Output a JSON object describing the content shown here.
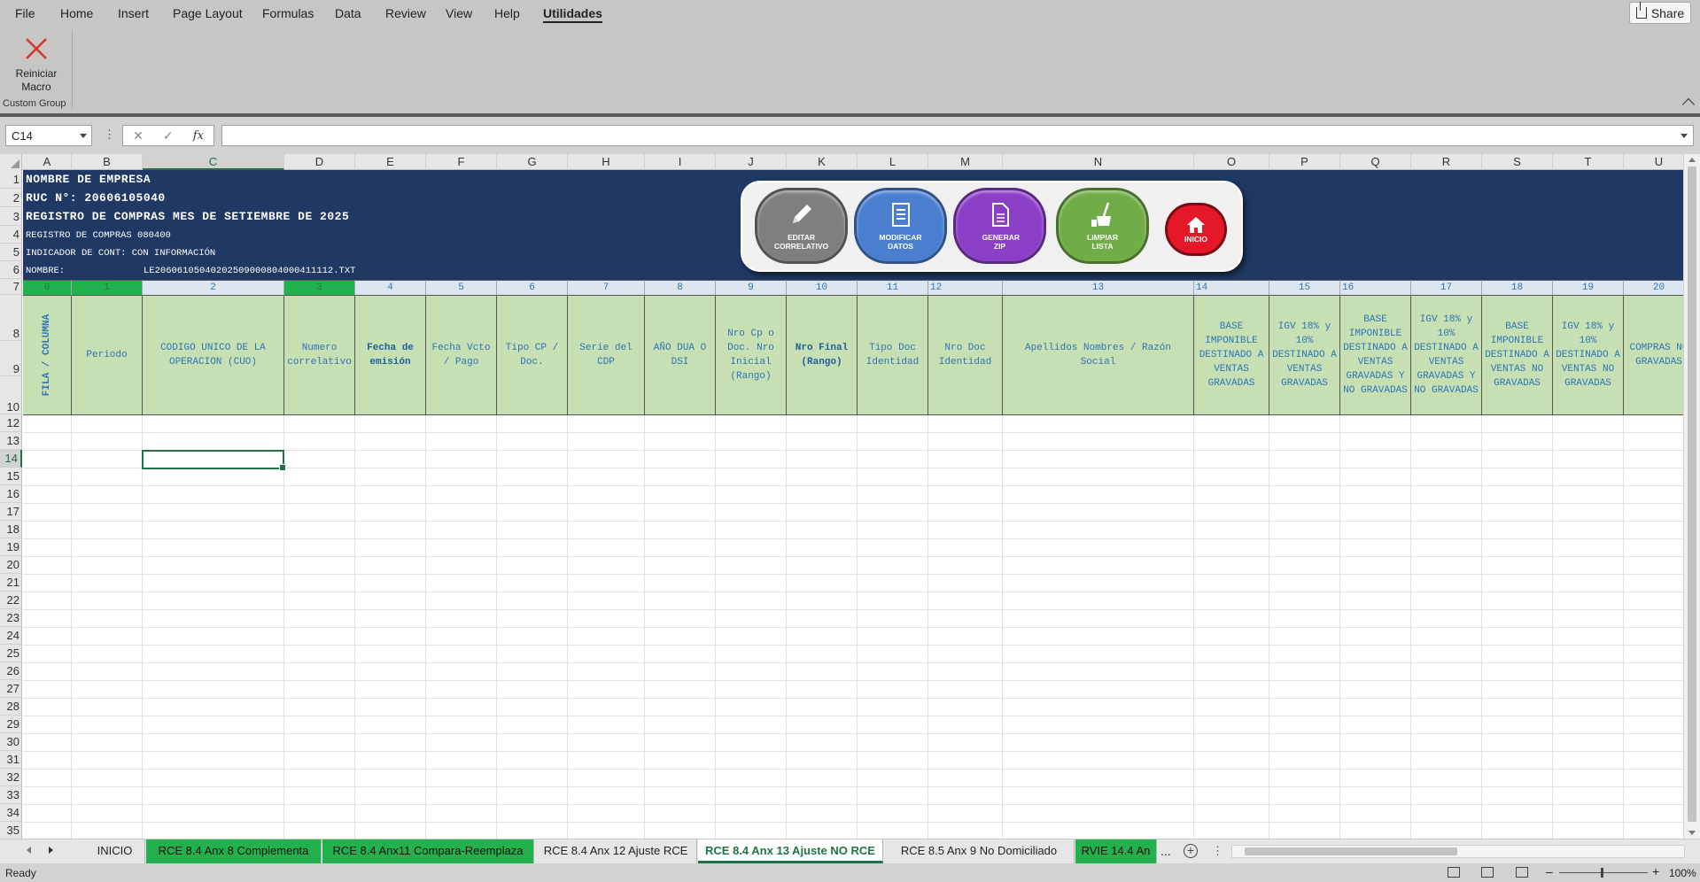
{
  "menu": [
    "File",
    "Home",
    "Insert",
    "Page Layout",
    "Formulas",
    "Data",
    "Review",
    "View",
    "Help",
    "Utilidades"
  ],
  "active_menu": "Utilidades",
  "share_label": "Share",
  "ribbon": {
    "macro_label_1": "Reiniciar",
    "macro_label_2": "Macro",
    "group_label": "Custom Group"
  },
  "formula_bar": {
    "name_box": "C14",
    "formula": "",
    "fx": "fx"
  },
  "columns": [
    "A",
    "B",
    "C",
    "D",
    "E",
    "F",
    "G",
    "H",
    "I",
    "J",
    "K",
    "L",
    "M",
    "N",
    "O",
    "P",
    "Q",
    "R",
    "S",
    "T",
    "U"
  ],
  "selected_column": "C",
  "rows": [
    "1",
    "2",
    "3",
    "4",
    "5",
    "6",
    "7",
    "8",
    "9",
    "10",
    "12",
    "13",
    "14",
    "15",
    "16",
    "17",
    "18",
    "19",
    "20",
    "21",
    "22",
    "23",
    "24",
    "25",
    "26",
    "27",
    "28",
    "29",
    "30",
    "31",
    "32",
    "33",
    "34",
    "35"
  ],
  "selected_row": "14",
  "banner": {
    "empresa": "NOMBRE DE EMPRESA",
    "ruc": "RUC N°: 20606105040",
    "titulo": "REGISTRO DE COMPRAS MES DE SETIEMBRE DE 2025",
    "registro": "REGISTRO DE COMPRAS 080400",
    "indicador": "INDICADOR DE CONT: CON INFORMACIÓN",
    "nombre_label": "NOMBRE:",
    "nombre_value": "LE20606105040202509000804000411112.TXT"
  },
  "buttons": {
    "editar": "EDITAR CORRELATIVO",
    "modificar": "MODIFICAR DATOS",
    "generar": "GENERAR ZIP",
    "limpiar": "LIMPIAR LISTA",
    "inicio": "INICIO"
  },
  "column_numbers": [
    "0",
    "1",
    "2",
    "3",
    "4",
    "5",
    "6",
    "7",
    "8",
    "9",
    "10",
    "11",
    "12",
    "13",
    "14",
    "15",
    "16",
    "17",
    "18",
    "19",
    "20"
  ],
  "headers": [
    "FILA / COLUMNA",
    "Periodo",
    "CODIGO UNICO DE LA OPERACION (CUO)",
    "Numero correlativo",
    "Fecha de emisión",
    "Fecha Vcto / Pago",
    "Tipo CP / Doc.",
    "Serie del CDP",
    "AÑO DUA O DSI",
    "Nro Cp o Doc. Nro Inicial (Rango)",
    "Nro Final (Rango)",
    "Tipo Doc Identidad",
    "Nro Doc Identidad",
    "Apellidos Nombres / Razón Social",
    "BASE IMPONIBLE DESTINADO A VENTAS GRAVADAS",
    "IGV 18% y 10% DESTINADO A VENTAS GRAVADAS",
    "BASE IMPONIBLE DESTINADO A VENTAS GRAVADAS Y NO GRAVADAS",
    "IGV 18% y 10% DESTINADO A VENTAS GRAVADAS Y NO GRAVADAS",
    "BASE IMPONIBLE DESTINADO A VENTAS NO GRAVADAS",
    "IGV 18% y 10% DESTINADO A VENTAS NO GRAVADAS",
    "COMPRAS NO GRAVADAS"
  ],
  "sheet_tabs": [
    {
      "label": "INICIO",
      "style": "plain"
    },
    {
      "label": "RCE 8.4 Anx 8 Complementa",
      "style": "green"
    },
    {
      "label": "RCE 8.4 Anx11 Compara-Reemplaza",
      "style": "green"
    },
    {
      "label": "RCE 8.4 Anx 12 Ajuste RCE",
      "style": "plain"
    },
    {
      "label": "RCE 8.4 Anx 13 Ajuste NO RCE",
      "style": "active"
    },
    {
      "label": "RCE 8.5 Anx 9 No Domiciliado",
      "style": "plain"
    },
    {
      "label": "RVIE 14.4 An",
      "style": "green"
    }
  ],
  "tab_ellipsis": "...",
  "status": {
    "ready": "Ready",
    "zoom": "100%"
  },
  "colors": {
    "banner": "#1f3864",
    "header_green": "#c6e0b4",
    "accent": "#217346",
    "tab_green": "#22b14c"
  }
}
